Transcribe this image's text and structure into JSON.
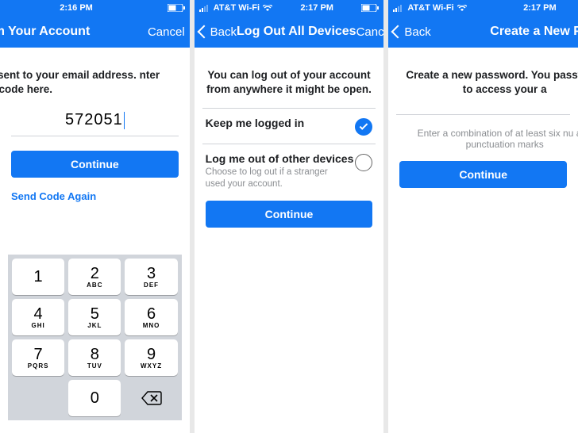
{
  "status": {
    "time_left": "2:16 PM",
    "time_mid": "2:17 PM",
    "time_right": "2:17 PM",
    "carrier": "AT&T Wi-Fi"
  },
  "screen1": {
    "title": "nfirm Your Account",
    "cancel": "Cancel",
    "prompt": "een sent to your email address. nter that code here.",
    "code_value": "572051",
    "continue": "Continue",
    "resend": "Send Code Again"
  },
  "screen2": {
    "back": "Back",
    "title": "Log Out All Devices",
    "cancel": "Cancel",
    "prompt": "You can log out of your account from anywhere it might be open.",
    "options": [
      {
        "title": "Keep me logged in",
        "subtitle": "",
        "selected": true
      },
      {
        "title": "Log me out of other devices",
        "subtitle": "Choose to log out if a stranger used your account.",
        "selected": false
      }
    ],
    "continue": "Continue"
  },
  "screen3": {
    "back": "Back",
    "title": "Create a New Passw",
    "prompt": "Create a new password. You password to access your a",
    "helper": "Enter a combination of at least six nu and punctuation marks",
    "continue": "Continue"
  },
  "keypad": {
    "keys": [
      {
        "num": "1",
        "letters": ""
      },
      {
        "num": "2",
        "letters": "ABC"
      },
      {
        "num": "3",
        "letters": "DEF"
      },
      {
        "num": "4",
        "letters": "GHI"
      },
      {
        "num": "5",
        "letters": "JKL"
      },
      {
        "num": "6",
        "letters": "MNO"
      },
      {
        "num": "7",
        "letters": "PQRS"
      },
      {
        "num": "8",
        "letters": "TUV"
      },
      {
        "num": "9",
        "letters": "WXYZ"
      },
      {
        "num": "",
        "letters": "",
        "blank": true
      },
      {
        "num": "0",
        "letters": ""
      },
      {
        "num": "",
        "letters": "",
        "backspace": true
      }
    ]
  }
}
